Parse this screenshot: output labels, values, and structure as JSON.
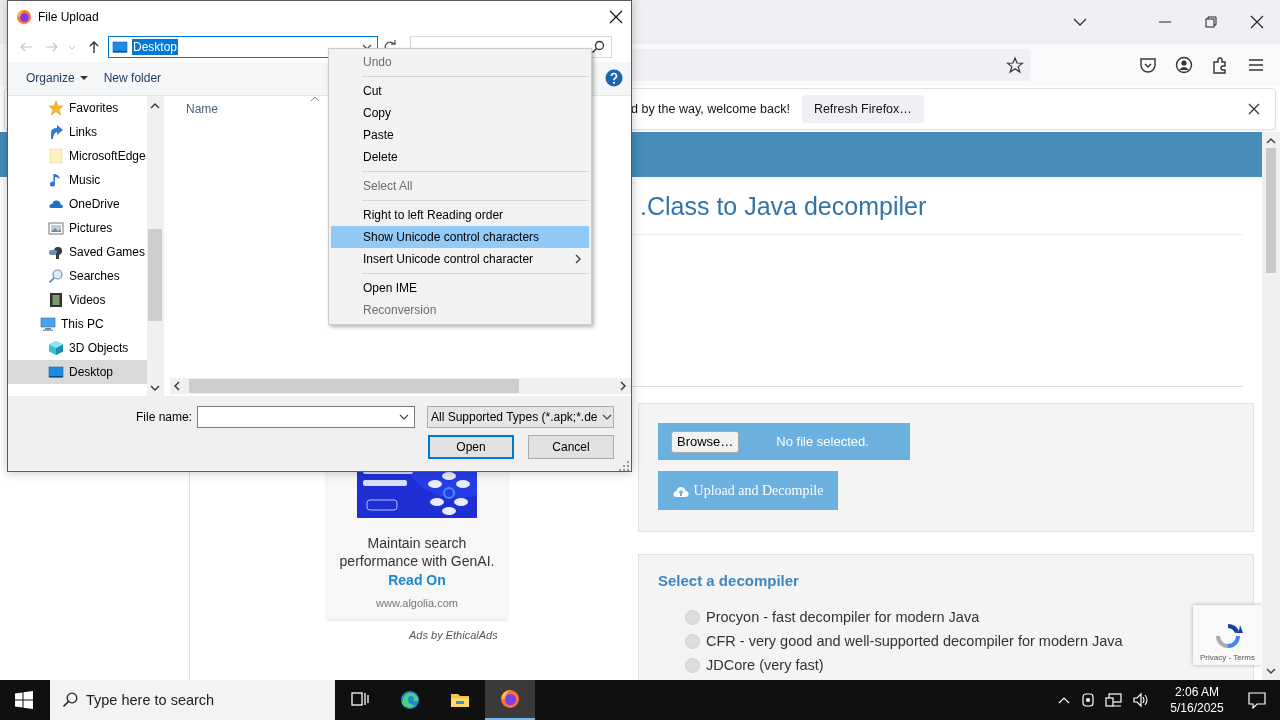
{
  "browser": {
    "notification": {
      "message": "d by the way, welcome back!",
      "button": "Refresh Firefox…"
    },
    "page": {
      "title": ".Class to Java decompiler",
      "ad": {
        "kind": "picture",
        "text": "Maintain search performance with GenAI.",
        "link": "Read On",
        "domain": "www.algolia.com",
        "credit": "Ads by EthicalAds"
      },
      "upload": {
        "browse_button": "Browse…",
        "file_status": "No file selected.",
        "submit_button": "Upload and Decompile"
      },
      "decompilers": {
        "heading": "Select a decompiler",
        "options": [
          {
            "label": "Procyon - fast decompiler for modern Java",
            "selected": false
          },
          {
            "label": "CFR - very good and well-supported decompiler for modern Java",
            "selected": false
          },
          {
            "label": "JDCore (very fast)",
            "selected": false
          }
        ]
      },
      "recaptcha": {
        "links": "Privacy - Terms"
      }
    }
  },
  "dialog": {
    "title": "File Upload",
    "address": {
      "text": "Desktop",
      "text_selected": true
    },
    "toolbar": [
      {
        "label": "Organize",
        "kind": "menu"
      },
      {
        "label": "New folder",
        "kind": "button"
      }
    ],
    "nav_tree": [
      {
        "label": "Favorites",
        "kind": "star",
        "selected": false
      },
      {
        "label": "Links",
        "kind": "links",
        "selected": false
      },
      {
        "label": "MicrosoftEdge",
        "kind": "folder",
        "selected": false
      },
      {
        "label": "Music",
        "kind": "music",
        "selected": false
      },
      {
        "label": "OneDrive",
        "kind": "cloud",
        "selected": false
      },
      {
        "label": "Pictures",
        "kind": "pictures",
        "selected": false
      },
      {
        "label": "Saved Games",
        "kind": "games",
        "selected": false
      },
      {
        "label": "Searches",
        "kind": "search",
        "selected": false
      },
      {
        "label": "Videos",
        "kind": "videos",
        "selected": false
      },
      {
        "label": "This PC",
        "kind": "pc",
        "selected": false,
        "children": [
          {
            "label": "3D Objects",
            "kind": "cube",
            "selected": false
          },
          {
            "label": "Desktop",
            "kind": "desktop",
            "selected": true
          }
        ]
      }
    ],
    "column": "Name",
    "file_name_label": "File name:",
    "file_type": "All Supported Types (*.apk;*.de",
    "buttons": [
      {
        "label": "Open",
        "default": true
      },
      {
        "label": "Cancel",
        "default": false
      }
    ]
  },
  "context_menu": {
    "items": [
      {
        "kind": "item",
        "label": "Undo",
        "disabled": true,
        "selected": false,
        "submenu": false
      },
      {
        "kind": "separator"
      },
      {
        "kind": "item",
        "label": "Cut",
        "disabled": false,
        "selected": false,
        "submenu": false
      },
      {
        "kind": "item",
        "label": "Copy",
        "disabled": false,
        "selected": false,
        "submenu": false
      },
      {
        "kind": "item",
        "label": "Paste",
        "disabled": false,
        "selected": false,
        "submenu": false
      },
      {
        "kind": "item",
        "label": "Delete",
        "disabled": false,
        "selected": false,
        "submenu": false
      },
      {
        "kind": "separator"
      },
      {
        "kind": "item",
        "label": "Select All",
        "disabled": true,
        "selected": false,
        "submenu": false
      },
      {
        "kind": "separator"
      },
      {
        "kind": "item",
        "label": "Right to left Reading order",
        "disabled": false,
        "selected": false,
        "submenu": false
      },
      {
        "kind": "item",
        "label": "Show Unicode control characters",
        "disabled": false,
        "selected": true,
        "submenu": false
      },
      {
        "kind": "item",
        "label": "Insert Unicode control character",
        "disabled": false,
        "selected": false,
        "submenu": true
      },
      {
        "kind": "separator"
      },
      {
        "kind": "item",
        "label": "Open IME",
        "disabled": false,
        "selected": false,
        "submenu": false
      },
      {
        "kind": "item",
        "label": "Reconversion",
        "disabled": true,
        "selected": false,
        "submenu": false
      }
    ]
  },
  "taskbar": {
    "search_placeholder": "Type here to search",
    "apps": [
      {
        "kind": "task-view",
        "active": false
      },
      {
        "kind": "edge",
        "active": false
      },
      {
        "kind": "explorer",
        "active": false
      },
      {
        "kind": "firefox",
        "active": true
      }
    ],
    "time": "2:06 AM",
    "date": "5/16/2025"
  }
}
